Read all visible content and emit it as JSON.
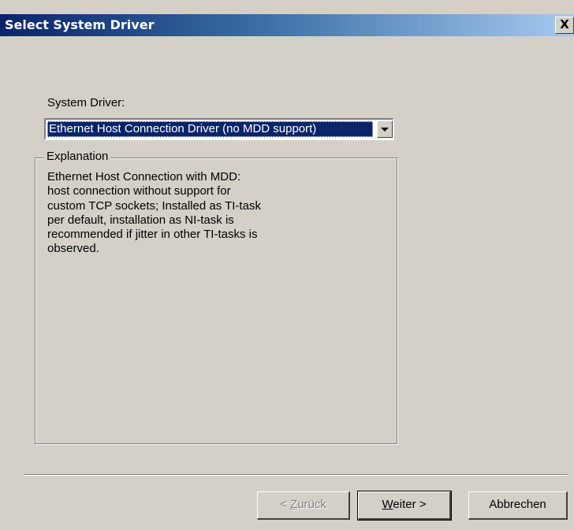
{
  "window": {
    "title": "Select System Driver",
    "close_label": "X"
  },
  "system_driver": {
    "label": "System Driver:",
    "selected_value": "Ethernet Host Connection Driver (no MDD support)"
  },
  "explanation": {
    "legend": "Explanation",
    "text": "Ethernet Host Connection with MDD:\nhost connection without support for\ncustom TCP sockets; Installed as TI-task\nper default, installation as NI-task is\nrecommended if jitter in other TI-tasks is\nobserved."
  },
  "buttons": {
    "back": {
      "prefix": "< ",
      "mnemonic": "Z",
      "rest": "urück",
      "enabled": false
    },
    "next": {
      "mnemonic": "W",
      "rest": "eiter >",
      "enabled": true
    },
    "cancel": {
      "label": "Abbrechen",
      "enabled": true
    }
  },
  "colors": {
    "dialog_bg": "#d4d0c8",
    "titlebar_start": "#0a246a",
    "titlebar_end": "#a6caf0",
    "selection": "#0a246a"
  },
  "icons": {
    "close": "close-icon",
    "dropdown": "chevron-down-icon"
  }
}
